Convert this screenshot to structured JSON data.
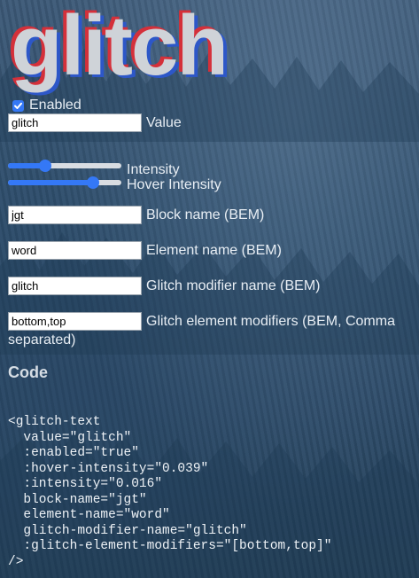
{
  "title": "glitch",
  "enabled": {
    "label": "Enabled",
    "checked": true
  },
  "value": {
    "input": "glitch",
    "label": "Value"
  },
  "intensity": {
    "label": "Intensity",
    "fraction": 0.33
  },
  "hover_intensity": {
    "label": "Hover Intensity",
    "fraction": 0.75
  },
  "block_name": {
    "input": "jgt",
    "label": "Block name (BEM)"
  },
  "element_name": {
    "input": "word",
    "label": "Element name (BEM)"
  },
  "modifier_name": {
    "input": "glitch",
    "label": "Glitch modifier name (BEM)"
  },
  "element_modifiers": {
    "input": "bottom,top",
    "label": "Glitch element modifiers (BEM, Comma separated)"
  },
  "code_heading": "Code",
  "code": "<glitch-text\n  value=\"glitch\"\n  :enabled=\"true\"\n  :hover-intensity=\"0.039\"\n  :intensity=\"0.016\"\n  block-name=\"jgt\"\n  element-name=\"word\"\n  glitch-modifier-name=\"glitch\"\n  :glitch-element-modifiers=\"[bottom,top]\"\n/>",
  "colors": {
    "accent": "#3478f6",
    "glitch_red": "#d4303a",
    "glitch_blue": "#2d57c8"
  }
}
